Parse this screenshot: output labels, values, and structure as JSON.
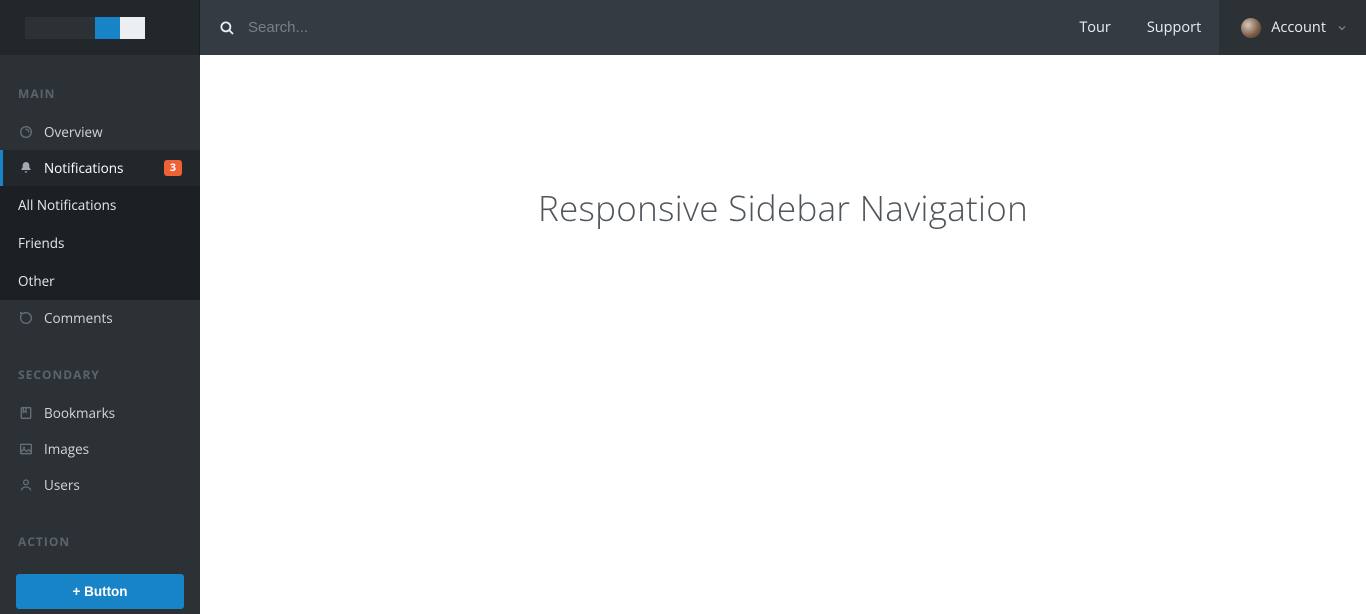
{
  "topbar": {
    "search_placeholder": "Search...",
    "tour": "Tour",
    "support": "Support",
    "account": "Account"
  },
  "sidebar": {
    "sections": {
      "main": {
        "title": "MAIN",
        "items": [
          {
            "label": "Overview"
          },
          {
            "label": "Notifications",
            "badge": "3"
          },
          {
            "label": "Comments"
          }
        ],
        "notifications_sub": [
          {
            "label": "All Notifications"
          },
          {
            "label": "Friends"
          },
          {
            "label": "Other"
          }
        ]
      },
      "secondary": {
        "title": "SECONDARY",
        "items": [
          {
            "label": "Bookmarks"
          },
          {
            "label": "Images"
          },
          {
            "label": "Users"
          }
        ]
      },
      "action": {
        "title": "ACTION",
        "button": "+ Button"
      }
    }
  },
  "content": {
    "heading": "Responsive Sidebar Navigation"
  }
}
